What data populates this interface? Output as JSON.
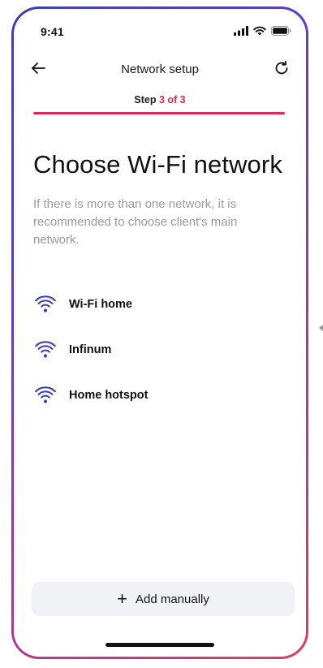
{
  "status_bar": {
    "time": "9:41",
    "icons": [
      "signal-icon",
      "wifi-icon",
      "battery-icon"
    ]
  },
  "header": {
    "title": "Network setup",
    "back_icon": "arrow-left-icon",
    "refresh_icon": "refresh-icon"
  },
  "step": {
    "prefix": "Step ",
    "current": "3 of 3",
    "progress": 1.0
  },
  "page": {
    "title": "Choose Wi-Fi network",
    "description": "If there is more than one network, it is recommended to choose client's main network."
  },
  "networks": [
    {
      "name": "Wi-Fi home",
      "icon": "wifi-icon"
    },
    {
      "name": "Infinum",
      "icon": "wifi-icon"
    },
    {
      "name": "Home hotspot",
      "icon": "wifi-icon"
    }
  ],
  "add_manually": {
    "icon": "+",
    "label": "Add manually"
  },
  "colors": {
    "accent": "#e0285a",
    "wifi_icon": "#3b3fb5",
    "muted_text": "#9a9a9a",
    "button_bg": "#f1f2f5"
  }
}
